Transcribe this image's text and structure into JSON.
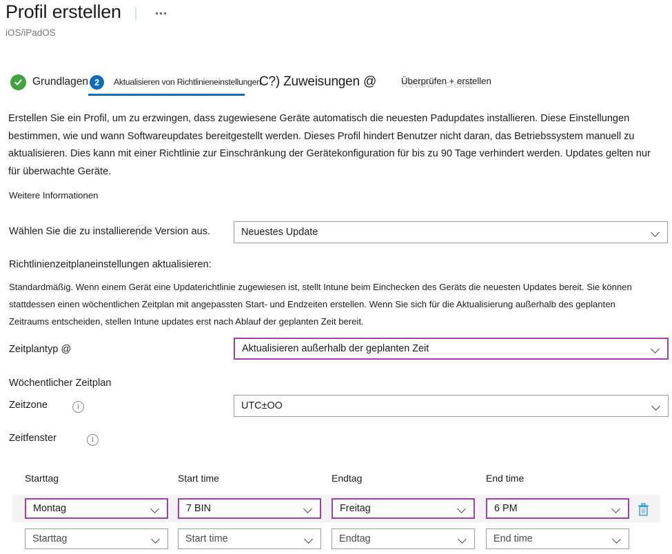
{
  "header": {
    "title": "Profil erstellen",
    "subtitle": "iOS/iPadOS",
    "more_icon": "ellipsis-icon"
  },
  "wizard": {
    "completed_icon": "check-circle-icon",
    "tabs": [
      {
        "label": "Grundlagen",
        "state": "completed"
      },
      {
        "label": "Aktualisieren von Richtlinieneinstellungen",
        "badge": "2",
        "state": "active"
      },
      {
        "label": "C?) Zuweisungen @",
        "state": "default"
      },
      {
        "label": "Überprüfen + erstellen",
        "ghost_label": "Review + create",
        "state": "default"
      }
    ],
    "accent_color": "#0f6cbd",
    "completed_color": "#3fa33f"
  },
  "content": {
    "intro": "Erstellen Sie ein Profil, um zu erzwingen, dass zugewiesene Geräte automatisch die neuesten Padupdates installieren. Diese Einstellungen bestimmen, wie und wann Softwareupdates bereitgestellt werden. Dieses Profil hindert Benutzer nicht daran, das Betriebssystem manuell zu aktualisieren. Dies kann mit einer Richtlinie zur Einschränkung der Gerätekonfiguration für bis zu 90 Tage verhindert werden. Updates gelten nur für überwachte Geräte.",
    "learn_more": "Weitere Informationen",
    "version_label": "Wählen Sie die zu installierende Version aus.",
    "version_value": "Neuestes Update",
    "policy_heading": "Richtlinienzeitplaneinstellungen aktualisieren:",
    "policy_description": "Standardmäßig. Wenn einem Gerät eine Updaterichtlinie zugewiesen ist, stellt Intune beim Einchecken des Geräts die neuesten Updates bereit. Sie können stattdessen einen wöchentlichen Zeitplan mit angepassten Start- und Endzeiten erstellen. Wenn Sie sich für die Aktualisierung außerhalb des geplanten Zeitraums entscheiden, stellen Intune updates erst nach Ablauf der geplanten Zeit bereit.",
    "scheduletype_label": "Zeitplantyp @",
    "scheduletype_value": "Aktualisieren außerhalb der geplanten Zeit",
    "weekly_heading": "Wöchentlicher Zeitplan",
    "timezone_label": "Zeitzone",
    "timezone_value": "UTC±OO",
    "window_label": "Zeitfenster",
    "info_icon": "info-icon",
    "accent_border_color": "#a33cb0"
  },
  "schedule_table": {
    "columns": [
      "Starttag",
      "Start time",
      "Endtag",
      "End time"
    ],
    "rows": [
      {
        "start_day": "Montag",
        "start_time": "7 BIN",
        "end_day": "Freitag",
        "end_time": "6 PM",
        "selected": true,
        "delete_icon": "trash-icon"
      },
      {
        "start_day": "Starttag",
        "start_time": "Start time",
        "end_day": "Endtag",
        "end_time": "End time",
        "selected": false
      }
    ]
  }
}
